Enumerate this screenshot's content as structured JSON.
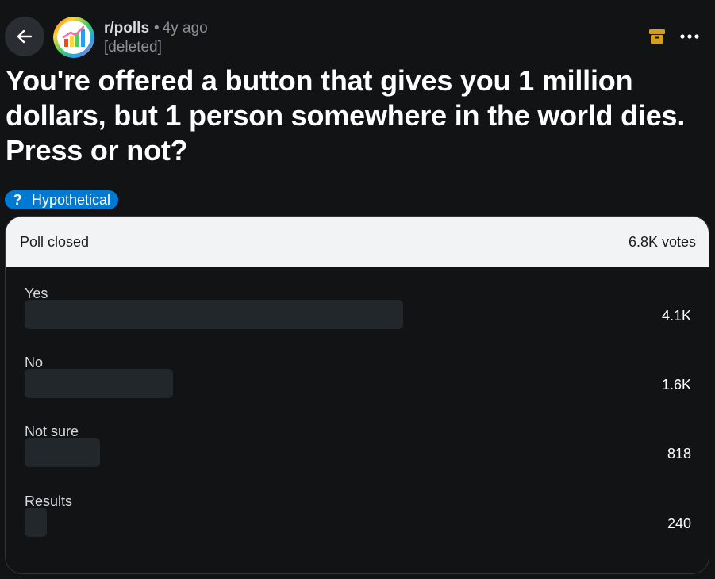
{
  "header": {
    "subreddit": "r/polls",
    "separator": "•",
    "age": "4y ago",
    "author": "[deleted]"
  },
  "post": {
    "title": "You're offered a button that gives you 1 million dollars, but 1 person somewhere in the world dies. Press or not?",
    "flair": {
      "icon": "?",
      "label": "Hypothetical",
      "color": "#0079d3"
    }
  },
  "poll": {
    "status": "Poll closed",
    "total_votes": "6.8K votes",
    "options": [
      {
        "label": "Yes",
        "count": "4.1K",
        "share": 0.6
      },
      {
        "label": "No",
        "count": "1.6K",
        "share": 0.235
      },
      {
        "label": "Not sure",
        "count": "818",
        "share": 0.12
      },
      {
        "label": "Results",
        "count": "240",
        "share": 0.035
      }
    ]
  },
  "icons": {
    "back": "arrow-left-icon",
    "avatar": "subreddit-avatar",
    "archive": "archive-icon",
    "more": "more-options-icon"
  },
  "colors": {
    "background": "#111315",
    "accent_archive": "#d4a017",
    "flair": "#0079d3",
    "poll_header": "#f2f3f5",
    "bar": "#22272b"
  }
}
